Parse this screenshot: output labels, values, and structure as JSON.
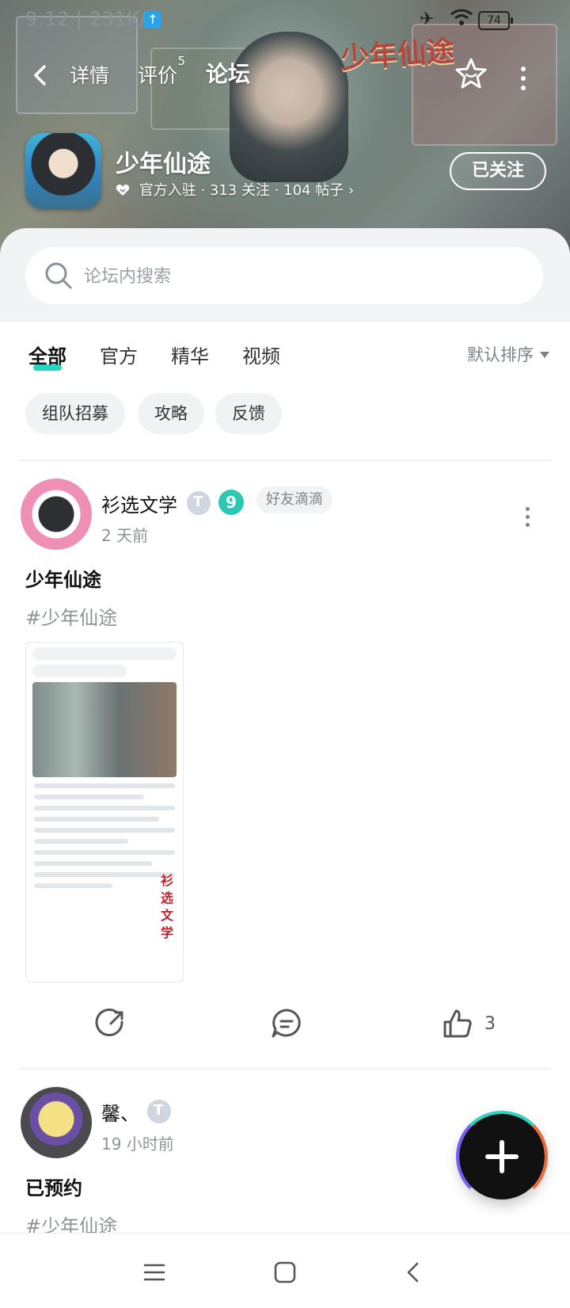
{
  "status_bar": {
    "time_speed": "9:12 | 231K/s",
    "battery": "74"
  },
  "nav": {
    "tabs": [
      {
        "label": "详情"
      },
      {
        "label": "评价",
        "count": "5"
      },
      {
        "label": "论坛"
      }
    ]
  },
  "game": {
    "name": "少年仙途",
    "meta": "官方入驻 · 313 关注 · 104 帖子",
    "follow_label": "已关注",
    "logo_text": "少年仙途"
  },
  "search": {
    "placeholder": "论坛内搜索"
  },
  "filters": {
    "tabs": [
      "全部",
      "官方",
      "精华",
      "视频"
    ],
    "sort_label": "默认排序",
    "chips": [
      "组队招募",
      "攻略",
      "反馈"
    ]
  },
  "posts": [
    {
      "username": "衫选文学",
      "level": "9",
      "tag": "好友滴滴",
      "time": "2 天前",
      "title": "少年仙途",
      "hashtag": "#少年仙途",
      "screenshot_side_text": "衫选文学",
      "likes": "3"
    },
    {
      "username": "馨、",
      "time": "19 小时前",
      "title": "已预约",
      "hashtag": "#少年仙途"
    }
  ],
  "colors": {
    "accent": "#25d6c0",
    "muted": "#8e9398"
  }
}
